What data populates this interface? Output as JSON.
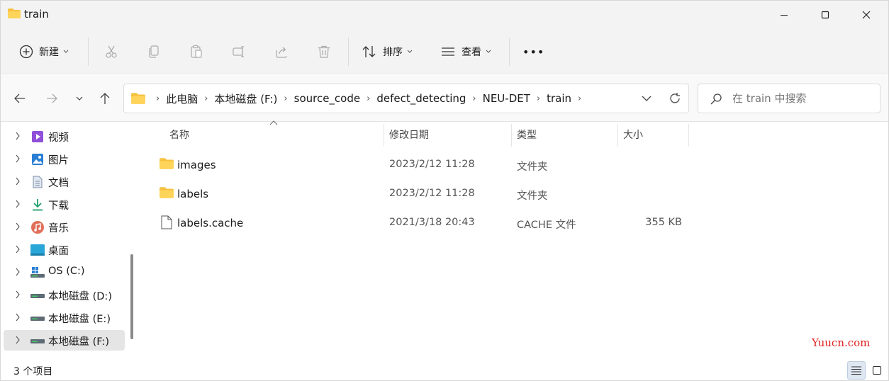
{
  "window": {
    "title": "train"
  },
  "toolbar": {
    "new_label": "新建",
    "sort_label": "排序",
    "view_label": "查看",
    "more_label": "•••"
  },
  "address": {
    "crumbs": [
      "此电脑",
      "本地磁盘 (F:)",
      "source_code",
      "defect_detecting",
      "NEU-DET",
      "train"
    ],
    "search_placeholder": "在 train 中搜索"
  },
  "sidebar": {
    "items": [
      {
        "label": "视频",
        "icon": "video-icon"
      },
      {
        "label": "图片",
        "icon": "pictures-icon"
      },
      {
        "label": "文档",
        "icon": "documents-icon"
      },
      {
        "label": "下载",
        "icon": "download-icon"
      },
      {
        "label": "音乐",
        "icon": "music-icon"
      },
      {
        "label": "桌面",
        "icon": "desktop-icon"
      },
      {
        "label": "OS (C:)",
        "icon": "os-drive-icon"
      },
      {
        "label": "本地磁盘 (D:)",
        "icon": "drive-icon"
      },
      {
        "label": "本地磁盘 (E:)",
        "icon": "drive-icon"
      },
      {
        "label": "本地磁盘 (F:)",
        "icon": "drive-icon",
        "selected": true
      }
    ]
  },
  "columns": {
    "name": "名称",
    "date": "修改日期",
    "type": "类型",
    "size": "大小"
  },
  "files": [
    {
      "name": "images",
      "date": "2023/2/12 11:28",
      "type": "文件夹",
      "size": "",
      "icon": "folder-icon"
    },
    {
      "name": "labels",
      "date": "2023/2/12 11:28",
      "type": "文件夹",
      "size": "",
      "icon": "folder-icon"
    },
    {
      "name": "labels.cache",
      "date": "2021/3/18 20:43",
      "type": "CACHE 文件",
      "size": "355 KB",
      "icon": "file-icon"
    }
  ],
  "status": {
    "item_count": "3 个项目"
  },
  "watermark": "Yuucn.com",
  "colors": {
    "folder": "#f5c242",
    "accent": "#0067c0",
    "watermark": "#e02020"
  }
}
